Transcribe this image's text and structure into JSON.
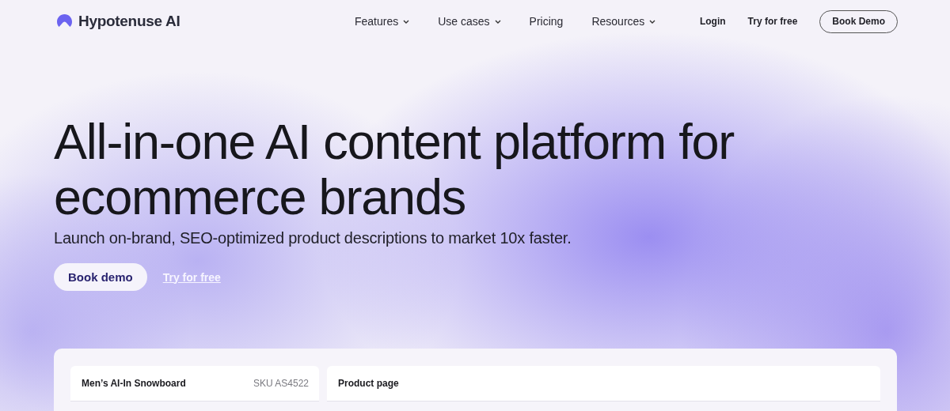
{
  "brand": {
    "name": "Hypotenuse AI"
  },
  "nav": [
    {
      "label": "Features",
      "has_menu": true
    },
    {
      "label": "Use cases",
      "has_menu": true
    },
    {
      "label": "Pricing",
      "has_menu": false
    },
    {
      "label": "Resources",
      "has_menu": true
    }
  ],
  "header_actions": {
    "login": "Login",
    "try": "Try for free",
    "demo": "Book Demo"
  },
  "hero": {
    "title": "All-in-one AI content platform for ecommerce brands",
    "subtitle": "Launch on-brand, SEO-optimized product descriptions to market 10x faster.",
    "primary": "Book demo",
    "secondary": "Try for free"
  },
  "preview": {
    "product": {
      "name": "Men’s AI-In Snowboard",
      "sku": "SKU AS4522"
    },
    "page": {
      "title": "Product page"
    }
  }
}
